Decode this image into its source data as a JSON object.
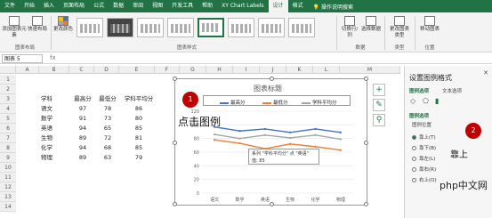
{
  "ribbon_tabs": [
    "文件",
    "开始",
    "插入",
    "页面布局",
    "公式",
    "数据",
    "审阅",
    "视图",
    "开发工具",
    "帮助",
    "XY Chart Labels",
    "设计",
    "格式"
  ],
  "ribbon_active_tab": "设计",
  "tell_me": "操作说明搜索",
  "ribbon": {
    "add_element": "添加图表元素",
    "quick_layout": "快速布局",
    "change_colors": "更改颜色",
    "layout_group": "图表布局",
    "styles_group": "图表样式",
    "switch_rowcol": "切换行/列",
    "select_data": "选择数据",
    "data_group": "数据",
    "change_type": "更改图表类型",
    "type_group": "类型",
    "move_chart": "移动图表",
    "location_group": "位置"
  },
  "name_box": "图表 5",
  "columns": [
    "A",
    "B",
    "C",
    "D",
    "E",
    "F",
    "G",
    "H",
    "I",
    "J",
    "K",
    "L",
    "M"
  ],
  "rows": [
    "1",
    "2",
    "3",
    "4",
    "5",
    "6",
    "7",
    "8",
    "9",
    "10",
    "11",
    "12",
    "13",
    "14"
  ],
  "table": {
    "headers": [
      "学科",
      "最高分",
      "最低分",
      "学科平均分"
    ],
    "rows": [
      [
        "语文",
        "97",
        "78",
        "86"
      ],
      [
        "数学",
        "91",
        "73",
        "80"
      ],
      [
        "英语",
        "94",
        "65",
        "85"
      ],
      [
        "生物",
        "89",
        "72",
        "81"
      ],
      [
        "化学",
        "94",
        "68",
        "85"
      ],
      [
        "物理",
        "89",
        "63",
        "79"
      ]
    ]
  },
  "chart": {
    "title": "图表标题",
    "tooltip_line1": "系列 \"学科平均分\" 点 \"英语\"",
    "tooltip_line2": "值: 85"
  },
  "chart_data": {
    "type": "line",
    "categories": [
      "语文",
      "数学",
      "英语",
      "生物",
      "化学",
      "物理"
    ],
    "series": [
      {
        "name": "最高分",
        "values": [
          97,
          91,
          94,
          89,
          94,
          89
        ],
        "color": "#4472c4"
      },
      {
        "name": "最低分",
        "values": [
          78,
          73,
          65,
          72,
          68,
          63
        ],
        "color": "#ed7d31"
      },
      {
        "name": "学科平均分",
        "values": [
          86,
          80,
          85,
          81,
          85,
          79
        ],
        "color": "#a5a5a5"
      }
    ],
    "ylim": [
      0,
      120
    ],
    "yticks": [
      "120",
      "100",
      "80",
      "60",
      "40",
      "20",
      "0"
    ],
    "legend": "top",
    "grid": true
  },
  "annotations": {
    "badge1": "1",
    "badge2": "2",
    "click_legend": "点击图例",
    "top_label": "靠上",
    "watermark": "php中文网"
  },
  "pane": {
    "title": "设置图例格式",
    "tab_options": "图例选项",
    "tab_text": "文本选项",
    "section": "图例选项",
    "position_label": "图例位置",
    "options": [
      "靠上(T)",
      "靠下(B)",
      "靠左(L)",
      "靠右(R)",
      "右上(O)"
    ],
    "selected_index": 0
  }
}
